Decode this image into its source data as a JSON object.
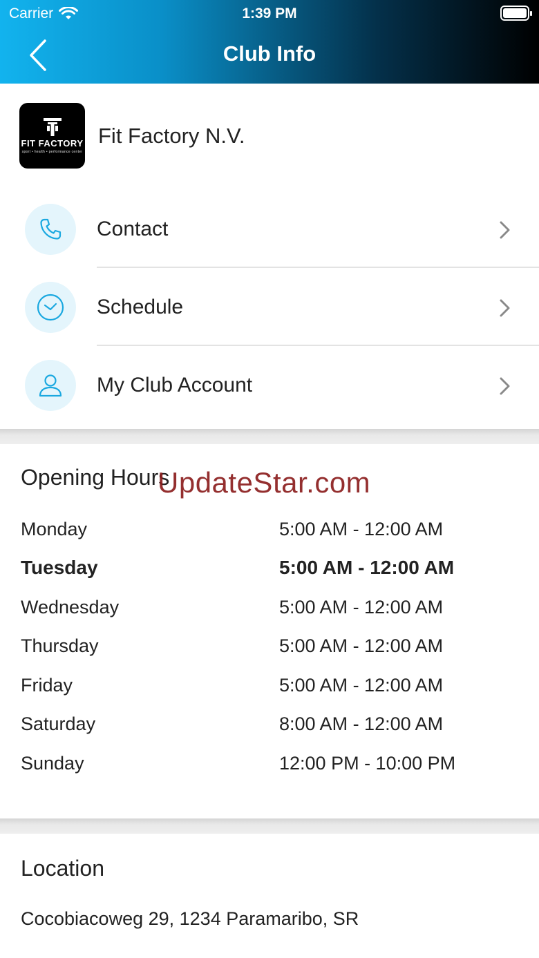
{
  "status_bar": {
    "carrier": "Carrier",
    "time": "1:39 PM"
  },
  "nav": {
    "title": "Club Info",
    "back_icon": "chevron-left-icon"
  },
  "club": {
    "name": "Fit Factory N.V.",
    "logo_text": "FIT FACTORY",
    "logo_subtext": "sport • health • performance center"
  },
  "menu": [
    {
      "label": "Contact",
      "icon": "phone-icon"
    },
    {
      "label": "Schedule",
      "icon": "clock-icon"
    },
    {
      "label": "My Club Account",
      "icon": "user-icon"
    }
  ],
  "opening_hours": {
    "title": "Opening Hours",
    "rows": [
      {
        "day": "Monday",
        "hours": "5:00 AM - 12:00 AM"
      },
      {
        "day": "Tuesday",
        "hours": "5:00 AM - 12:00 AM"
      },
      {
        "day": "Wednesday",
        "hours": "5:00 AM - 12:00 AM"
      },
      {
        "day": "Thursday",
        "hours": "5:00 AM - 12:00 AM"
      },
      {
        "day": "Friday",
        "hours": "5:00 AM - 12:00 AM"
      },
      {
        "day": "Saturday",
        "hours": "8:00 AM - 12:00 AM"
      },
      {
        "day": "Sunday",
        "hours": "12:00 PM - 10:00 PM"
      }
    ]
  },
  "watermark": "UpdateStar.com",
  "location": {
    "title": "Location",
    "address": "Cocobiacoweg 29, 1234 Paramaribo, SR"
  },
  "colors": {
    "accent": "#12b3ee",
    "icon_bg": "#e4f5fc",
    "watermark": "#8c1e1e"
  }
}
